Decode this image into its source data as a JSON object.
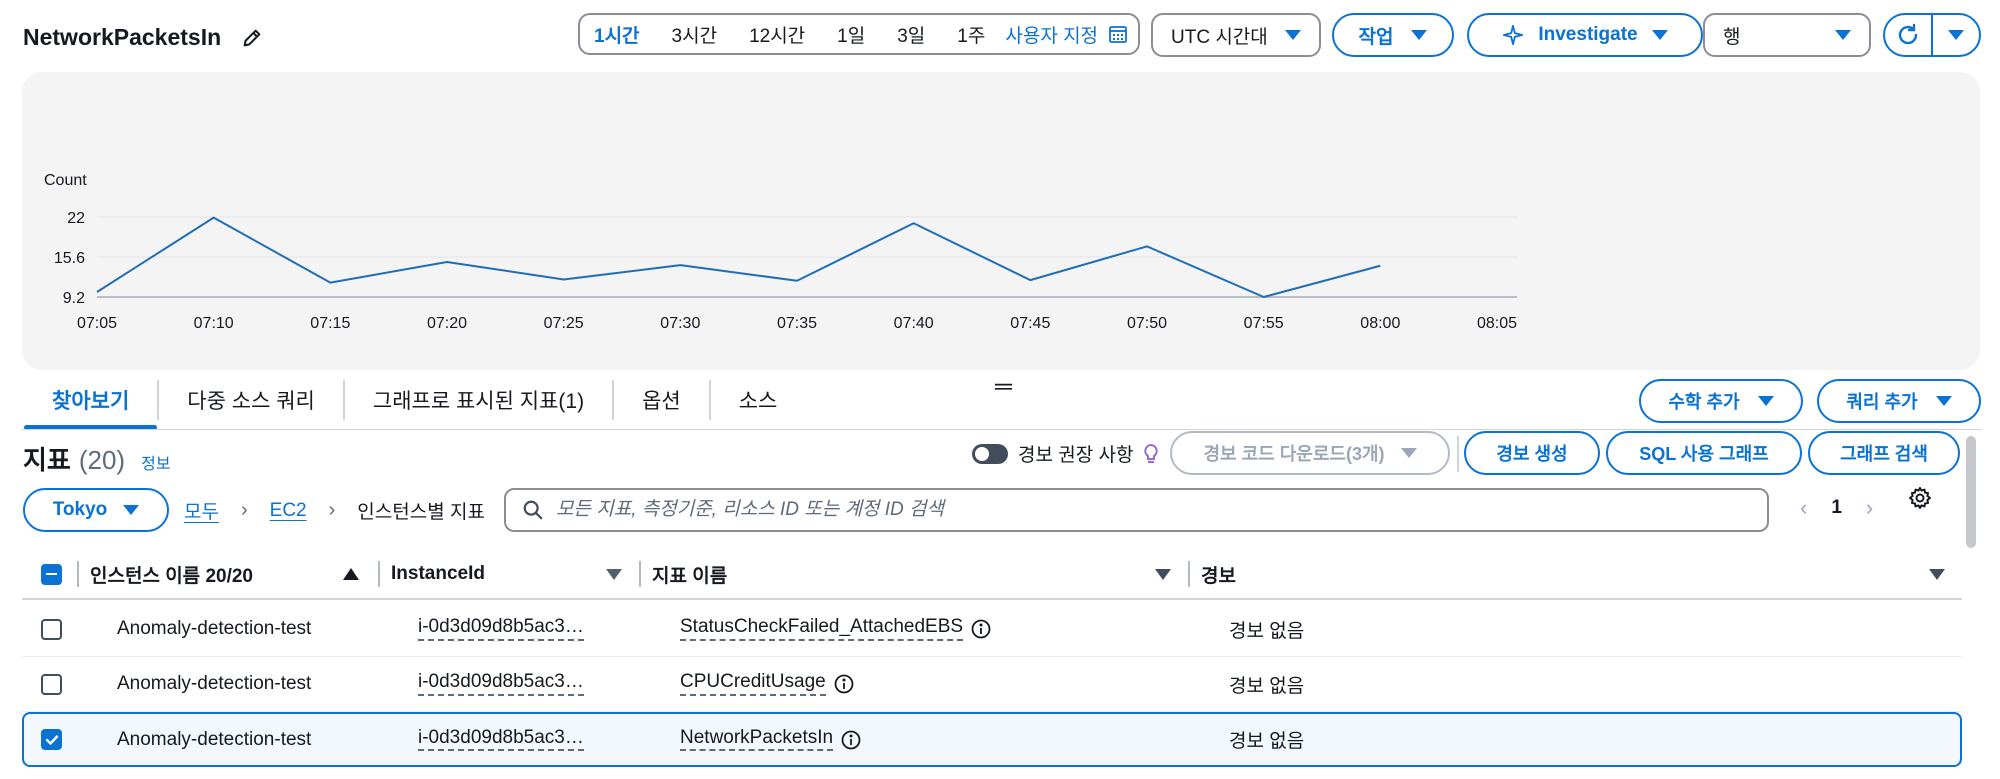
{
  "header": {
    "title": "NetworkPacketsIn",
    "time_ranges": [
      "1시간",
      "3시간",
      "12시간",
      "1일",
      "3일",
      "1주"
    ],
    "time_active_index": 0,
    "custom_label": "사용자 지정",
    "timezone_label": "UTC 시간대",
    "actions_label": "작업",
    "investigate_label": "Investigate",
    "view_label": "행"
  },
  "chart_data": {
    "type": "line",
    "ylabel": "Count",
    "y_ticks": [
      "9.2",
      "15.6",
      "22"
    ],
    "ylim": [
      9.2,
      22
    ],
    "x_ticks": [
      "07:05",
      "07:10",
      "07:15",
      "07:20",
      "07:25",
      "07:30",
      "07:35",
      "07:40",
      "07:45",
      "07:50",
      "07:55",
      "08:00",
      "08:05"
    ],
    "series": [
      {
        "x": [
          "07:05",
          "07:10",
          "07:15",
          "07:20",
          "07:25",
          "07:30",
          "07:35",
          "07:40",
          "07:45",
          "07:50",
          "07:55",
          "08:00"
        ],
        "values": [
          10.0,
          21.9,
          11.5,
          14.8,
          12.0,
          14.3,
          11.8,
          21.0,
          11.9,
          17.3,
          9.2,
          14.2
        ]
      }
    ],
    "color": "#1f6db5"
  },
  "tabs": {
    "items": [
      "찾아보기",
      "다중 소스 쿼리",
      "그래프로 표시된 지표(1)",
      "옵션",
      "소스"
    ],
    "active_index": 0,
    "add_math_label": "수학 추가",
    "add_query_label": "쿼리 추가"
  },
  "metrics": {
    "title": "지표",
    "count": "(20)",
    "info_label": "정보",
    "alarm_recommend_label": "경보 권장 사항",
    "download_alarm_code_label": "경보 코드 다운로드(3개)",
    "create_alarm_label": "경보 생성",
    "sql_graph_label": "SQL 사용 그래프",
    "graph_search_label": "그래프 검색",
    "region_label": "Tokyo",
    "breadcrumb": [
      "모두",
      "EC2",
      "인스턴스별 지표"
    ],
    "search_placeholder": "모든 지표, 측정기준, 리소스 ID 또는 계정 ID 검색",
    "page_number": "1"
  },
  "table": {
    "columns": [
      "인스턴스 이름 20/20",
      "InstanceId",
      "지표 이름",
      "경보"
    ],
    "rows": [
      {
        "instance_name": "Anomaly-detection-test",
        "instance_id": "i-0d3d09d8b5ac3…",
        "metric_name": "StatusCheckFailed_AttachedEBS",
        "alarm": "경보 없음",
        "checked": false
      },
      {
        "instance_name": "Anomaly-detection-test",
        "instance_id": "i-0d3d09d8b5ac3…",
        "metric_name": "CPUCreditUsage",
        "alarm": "경보 없음",
        "checked": false
      },
      {
        "instance_name": "Anomaly-detection-test",
        "instance_id": "i-0d3d09d8b5ac3…",
        "metric_name": "NetworkPacketsIn",
        "alarm": "경보 없음",
        "checked": true
      }
    ]
  }
}
